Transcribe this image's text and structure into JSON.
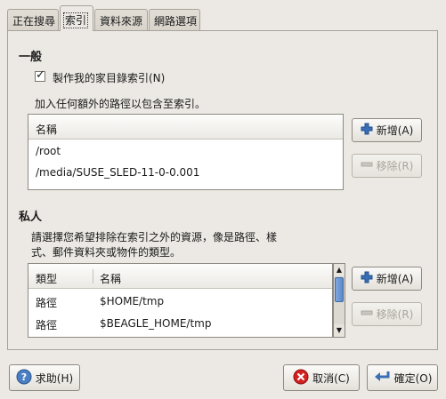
{
  "tabs": [
    {
      "label": "正在搜尋"
    },
    {
      "label": "索引"
    },
    {
      "label": "資料來源"
    },
    {
      "label": "網路選項"
    }
  ],
  "general": {
    "title": "一般",
    "checkbox_label": "製作我的家目錄索引(N)",
    "checked": true,
    "desc": "加入任何額外的路徑以包含至索引。",
    "table_header": "名稱",
    "rows": [
      "/root",
      "/media/SUSE_SLED-11-0-0.001"
    ],
    "add_label": "新增(A)",
    "remove_label": "移除(R)"
  },
  "private": {
    "title": "私人",
    "desc_line1": "請選擇您希望排除在索引之外的資源，像是路徑、樣",
    "desc_line2": "式、郵件資料夾或物件的類型。",
    "col_type": "類型",
    "col_name": "名稱",
    "rows": [
      {
        "type": "路徑",
        "name": "$HOME/tmp"
      },
      {
        "type": "路徑",
        "name": "$BEAGLE_HOME/tmp"
      }
    ],
    "add_label": "新增(A)",
    "remove_label": "移除(R)"
  },
  "footer": {
    "help_label": "求助(H)",
    "cancel_label": "取消(C)",
    "ok_label": "確定(O)"
  },
  "icons": {
    "add": "plus-icon",
    "remove": "minus-icon",
    "help": "help-icon",
    "cancel": "cancel-icon",
    "ok": "ok-icon"
  },
  "colors": {
    "accent_blue": "#3a6fb5",
    "cancel_red": "#d42020"
  }
}
